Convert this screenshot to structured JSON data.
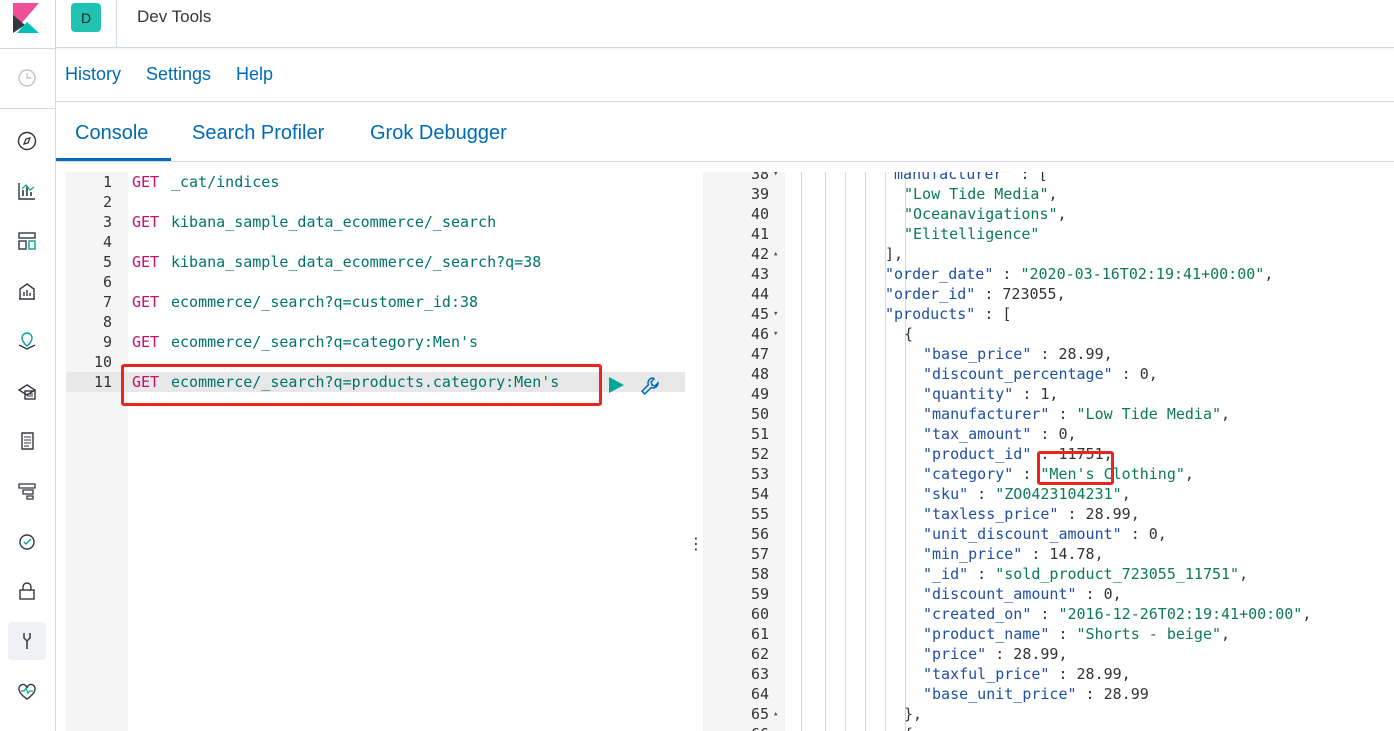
{
  "header": {
    "space_initial": "D",
    "app_title": "Dev Tools"
  },
  "top_menu": {
    "history": "History",
    "settings": "Settings",
    "help": "Help"
  },
  "tabs": [
    "Console",
    "Search Profiler",
    "Grok Debugger"
  ],
  "colors": {
    "accent": "#006bb4",
    "method": "#c80a68",
    "path": "#00746a",
    "highlight_box": "#e8251e",
    "space_badge": "#20c2b1"
  },
  "nav_icons": [
    "recent-icon",
    "discover-icon",
    "visualize-icon",
    "dashboard-icon",
    "canvas-icon",
    "maps-icon",
    "ml-icon",
    "logs-icon",
    "apm-icon",
    "uptime-icon",
    "security-icon",
    "dev-tools-icon",
    "monitoring-icon"
  ],
  "editor": {
    "lines": [
      {
        "n": "1",
        "method": "GET",
        "path": "_cat/indices"
      },
      {
        "n": "2",
        "method": "",
        "path": ""
      },
      {
        "n": "3",
        "method": "GET",
        "path": "kibana_sample_data_ecommerce/_search"
      },
      {
        "n": "4",
        "method": "",
        "path": ""
      },
      {
        "n": "5",
        "method": "GET",
        "path": "kibana_sample_data_ecommerce/_search?q=38"
      },
      {
        "n": "6",
        "method": "",
        "path": ""
      },
      {
        "n": "7",
        "method": "GET",
        "path": "ecommerce/_search?q=customer_id:38"
      },
      {
        "n": "8",
        "method": "",
        "path": ""
      },
      {
        "n": "9",
        "method": "GET",
        "path": "ecommerce/_search?q=category:Men's"
      },
      {
        "n": "10",
        "method": "",
        "path": ""
      },
      {
        "n": "11",
        "method": "GET",
        "path": "ecommerce/_search?q=products.category:Men's"
      }
    ]
  },
  "output": {
    "lines": [
      {
        "n": "38",
        "fold": "▾",
        "indent": 1,
        "parts": [
          [
            "k",
            "\"manufacturer\""
          ],
          [
            "p",
            " : ["
          ]
        ]
      },
      {
        "n": "39",
        "fold": "",
        "indent": 2,
        "parts": [
          [
            "s",
            "\"Low Tide Media\""
          ],
          [
            "p",
            ","
          ]
        ]
      },
      {
        "n": "40",
        "fold": "",
        "indent": 2,
        "parts": [
          [
            "s",
            "\"Oceanavigations\""
          ],
          [
            "p",
            ","
          ]
        ]
      },
      {
        "n": "41",
        "fold": "",
        "indent": 2,
        "parts": [
          [
            "s",
            "\"Elitelligence\""
          ]
        ]
      },
      {
        "n": "42",
        "fold": "▴",
        "indent": 1,
        "parts": [
          [
            "p",
            "],"
          ]
        ]
      },
      {
        "n": "43",
        "fold": "",
        "indent": 1,
        "parts": [
          [
            "k",
            "\"order_date\""
          ],
          [
            "p",
            " : "
          ],
          [
            "s",
            "\"2020-03-16T02:19:41+00:00\""
          ],
          [
            "p",
            ","
          ]
        ]
      },
      {
        "n": "44",
        "fold": "",
        "indent": 1,
        "parts": [
          [
            "k",
            "\"order_id\""
          ],
          [
            "p",
            " : 723055,"
          ]
        ]
      },
      {
        "n": "45",
        "fold": "▾",
        "indent": 1,
        "parts": [
          [
            "k",
            "\"products\""
          ],
          [
            "p",
            " : ["
          ]
        ]
      },
      {
        "n": "46",
        "fold": "▾",
        "indent": 2,
        "parts": [
          [
            "p",
            "{"
          ]
        ]
      },
      {
        "n": "47",
        "fold": "",
        "indent": 3,
        "parts": [
          [
            "k",
            "\"base_price\""
          ],
          [
            "p",
            " : 28.99,"
          ]
        ]
      },
      {
        "n": "48",
        "fold": "",
        "indent": 3,
        "parts": [
          [
            "k",
            "\"discount_percentage\""
          ],
          [
            "p",
            " : 0,"
          ]
        ]
      },
      {
        "n": "49",
        "fold": "",
        "indent": 3,
        "parts": [
          [
            "k",
            "\"quantity\""
          ],
          [
            "p",
            " : 1,"
          ]
        ]
      },
      {
        "n": "50",
        "fold": "",
        "indent": 3,
        "parts": [
          [
            "k",
            "\"manufacturer\""
          ],
          [
            "p",
            " : "
          ],
          [
            "s",
            "\"Low Tide Media\""
          ],
          [
            "p",
            ","
          ]
        ]
      },
      {
        "n": "51",
        "fold": "",
        "indent": 3,
        "parts": [
          [
            "k",
            "\"tax_amount\""
          ],
          [
            "p",
            " : 0,"
          ]
        ]
      },
      {
        "n": "52",
        "fold": "",
        "indent": 3,
        "parts": [
          [
            "k",
            "\"product_id\""
          ],
          [
            "p",
            " : 11751,"
          ]
        ]
      },
      {
        "n": "53",
        "fold": "",
        "indent": 3,
        "parts": [
          [
            "k",
            "\"category\""
          ],
          [
            "p",
            " : "
          ],
          [
            "s",
            "\"Men's Clothing\""
          ],
          [
            "p",
            ","
          ]
        ]
      },
      {
        "n": "54",
        "fold": "",
        "indent": 3,
        "parts": [
          [
            "k",
            "\"sku\""
          ],
          [
            "p",
            " : "
          ],
          [
            "s",
            "\"ZO0423104231\""
          ],
          [
            "p",
            ","
          ]
        ]
      },
      {
        "n": "55",
        "fold": "",
        "indent": 3,
        "parts": [
          [
            "k",
            "\"taxless_price\""
          ],
          [
            "p",
            " : 28.99,"
          ]
        ]
      },
      {
        "n": "56",
        "fold": "",
        "indent": 3,
        "parts": [
          [
            "k",
            "\"unit_discount_amount\""
          ],
          [
            "p",
            " : 0,"
          ]
        ]
      },
      {
        "n": "57",
        "fold": "",
        "indent": 3,
        "parts": [
          [
            "k",
            "\"min_price\""
          ],
          [
            "p",
            " : 14.78,"
          ]
        ]
      },
      {
        "n": "58",
        "fold": "",
        "indent": 3,
        "parts": [
          [
            "k",
            "\"_id\""
          ],
          [
            "p",
            " : "
          ],
          [
            "s",
            "\"sold_product_723055_11751\""
          ],
          [
            "p",
            ","
          ]
        ]
      },
      {
        "n": "59",
        "fold": "",
        "indent": 3,
        "parts": [
          [
            "k",
            "\"discount_amount\""
          ],
          [
            "p",
            " : 0,"
          ]
        ]
      },
      {
        "n": "60",
        "fold": "",
        "indent": 3,
        "parts": [
          [
            "k",
            "\"created_on\""
          ],
          [
            "p",
            " : "
          ],
          [
            "s",
            "\"2016-12-26T02:19:41+00:00\""
          ],
          [
            "p",
            ","
          ]
        ]
      },
      {
        "n": "61",
        "fold": "",
        "indent": 3,
        "parts": [
          [
            "k",
            "\"product_name\""
          ],
          [
            "p",
            " : "
          ],
          [
            "s",
            "\"Shorts - beige\""
          ],
          [
            "p",
            ","
          ]
        ]
      },
      {
        "n": "62",
        "fold": "",
        "indent": 3,
        "parts": [
          [
            "k",
            "\"price\""
          ],
          [
            "p",
            " : 28.99,"
          ]
        ]
      },
      {
        "n": "63",
        "fold": "",
        "indent": 3,
        "parts": [
          [
            "k",
            "\"taxful_price\""
          ],
          [
            "p",
            " : 28.99,"
          ]
        ]
      },
      {
        "n": "64",
        "fold": "",
        "indent": 3,
        "parts": [
          [
            "k",
            "\"base_unit_price\""
          ],
          [
            "p",
            " : 28.99"
          ]
        ]
      },
      {
        "n": "65",
        "fold": "▴",
        "indent": 2,
        "parts": [
          [
            "p",
            "},"
          ]
        ]
      },
      {
        "n": "66",
        "fold": "▾",
        "indent": 2,
        "parts": [
          [
            "p",
            "{"
          ]
        ]
      }
    ]
  }
}
